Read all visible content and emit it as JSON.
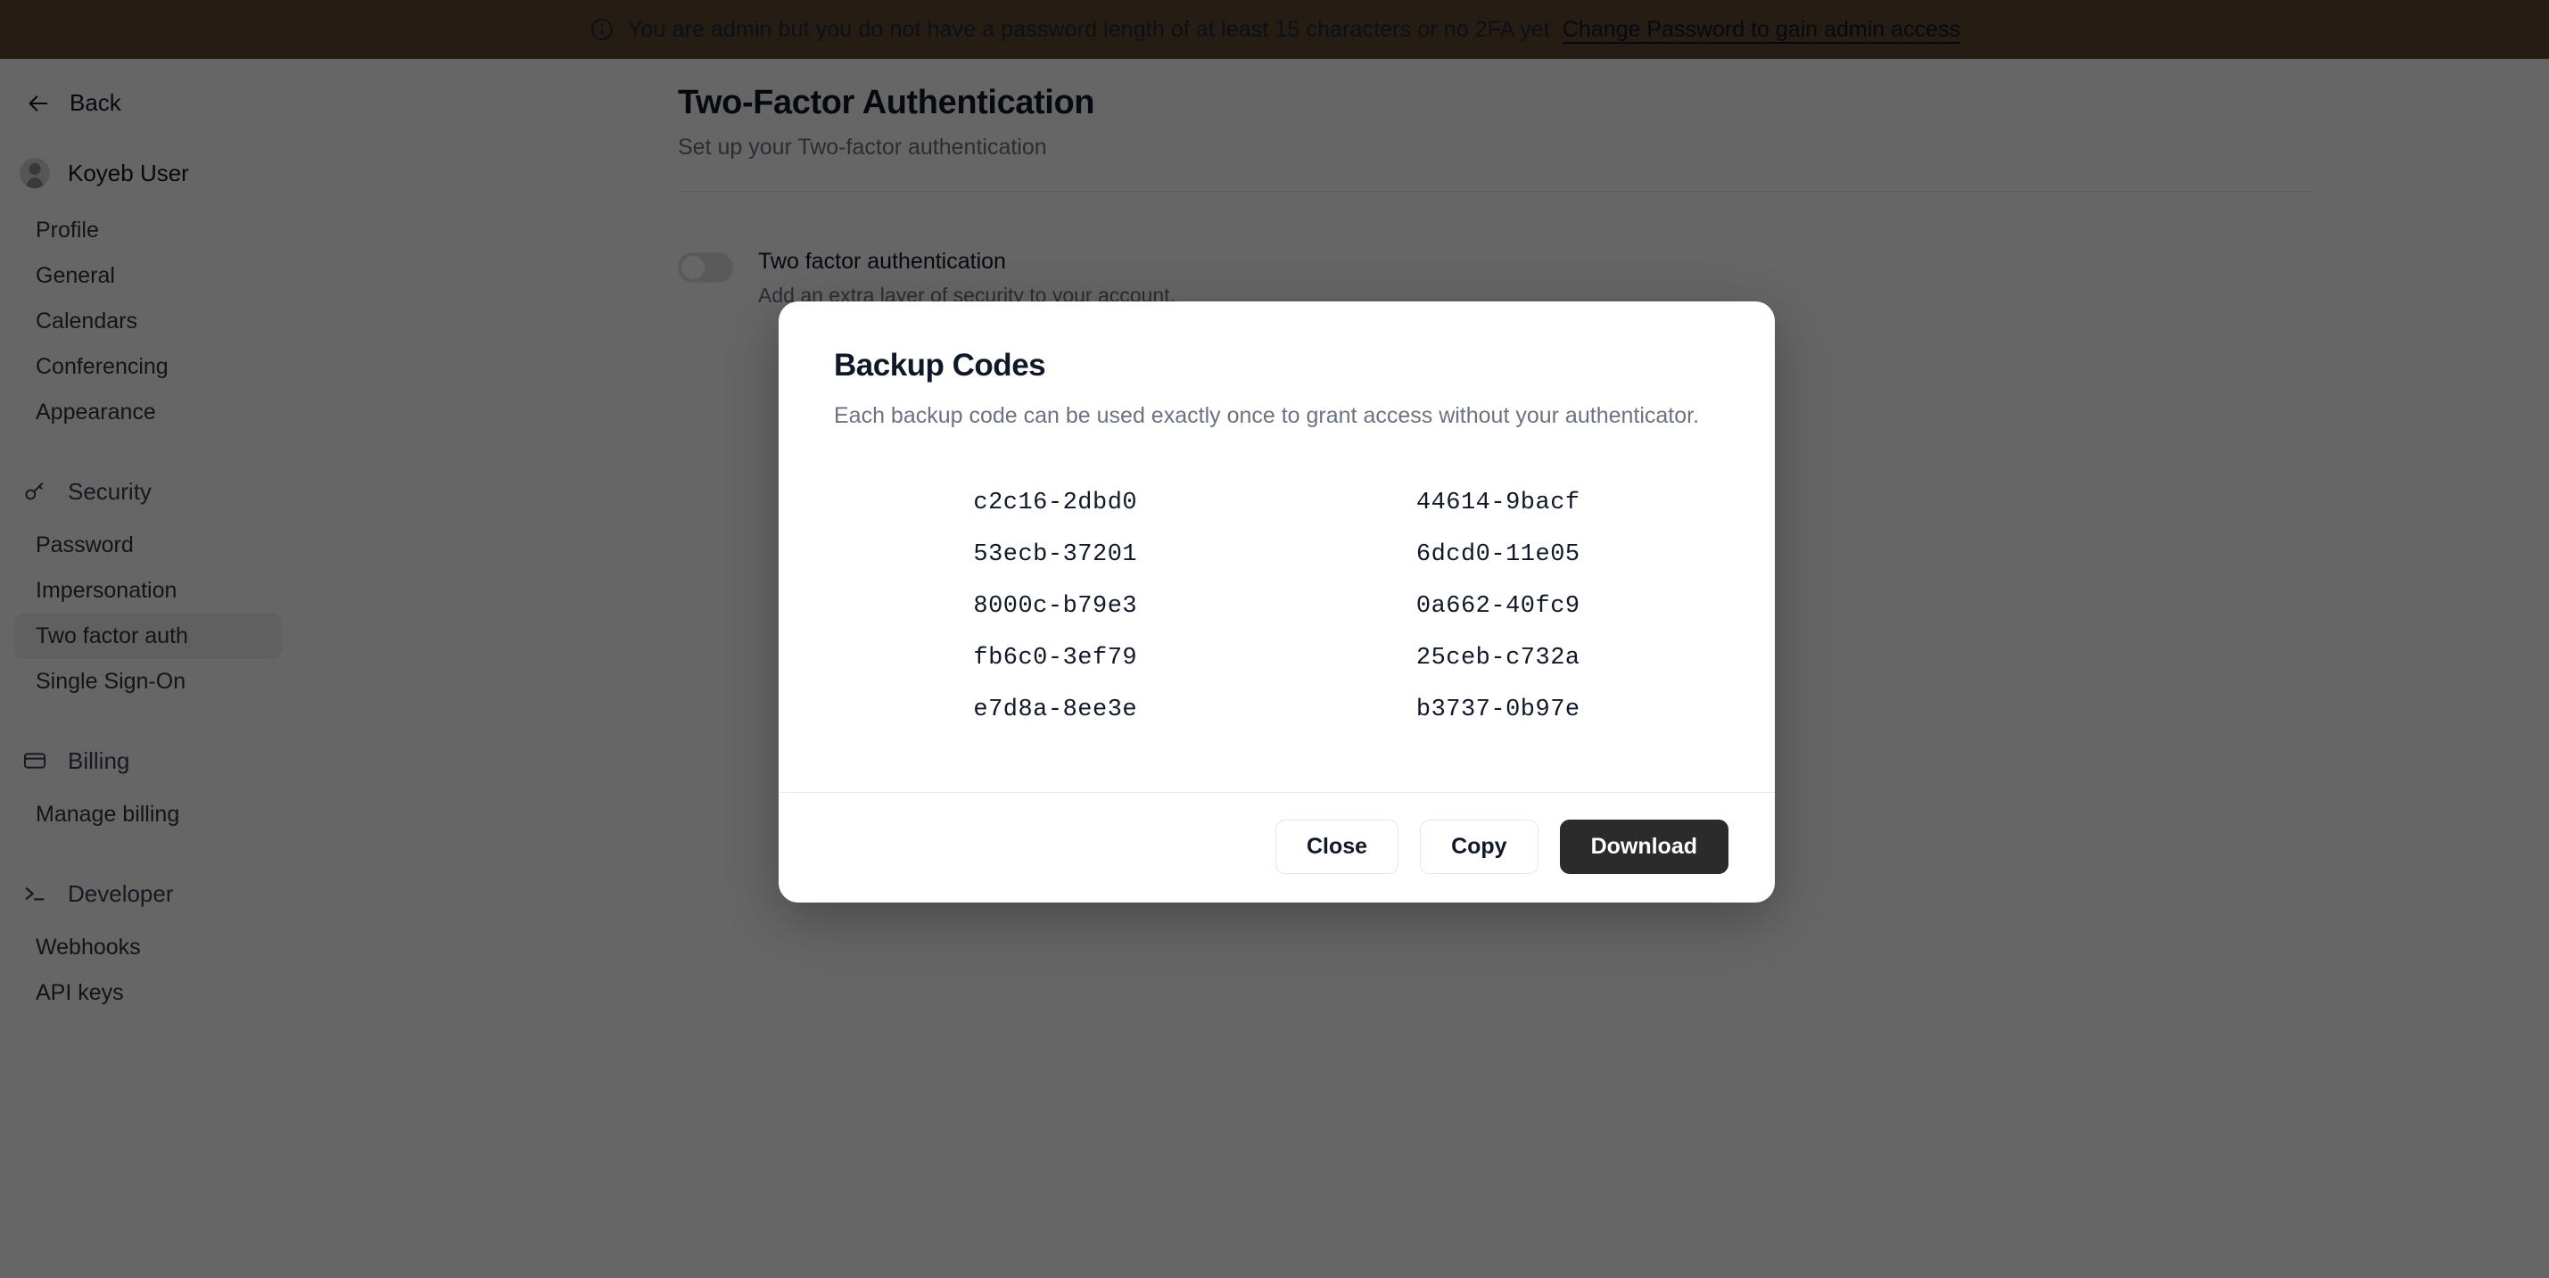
{
  "banner": {
    "icon": "info-circle-icon",
    "message": "You are admin but you do not have a password length of at least 15 characters or no 2FA yet",
    "link_label": "Change Password to gain admin access",
    "background_color": "#5d4634"
  },
  "sidebar": {
    "back_label": "Back",
    "back_icon": "arrow-left-icon",
    "user": {
      "name": "Koyeb User",
      "avatar_icon": "user-avatar-icon"
    },
    "account_items": [
      {
        "label": "Profile",
        "active": false
      },
      {
        "label": "General",
        "active": false
      },
      {
        "label": "Calendars",
        "active": false
      },
      {
        "label": "Conferencing",
        "active": false
      },
      {
        "label": "Appearance",
        "active": false
      }
    ],
    "groups": [
      {
        "label": "Security",
        "icon": "key-icon",
        "items": [
          {
            "label": "Password",
            "active": false
          },
          {
            "label": "Impersonation",
            "active": false
          },
          {
            "label": "Two factor auth",
            "active": true
          },
          {
            "label": "Single Sign-On",
            "active": false
          }
        ]
      },
      {
        "label": "Billing",
        "icon": "credit-card-icon",
        "items": [
          {
            "label": "Manage billing",
            "active": false
          }
        ]
      },
      {
        "label": "Developer",
        "icon": "terminal-icon",
        "items": [
          {
            "label": "Webhooks",
            "active": false
          },
          {
            "label": "API keys",
            "active": false
          }
        ]
      }
    ]
  },
  "main": {
    "title": "Two-Factor Authentication",
    "subtitle": "Set up your Two-factor authentication",
    "setting": {
      "toggle_on": false,
      "title": "Two factor authentication",
      "description": "Add an extra layer of security to your account."
    }
  },
  "modal": {
    "title": "Backup Codes",
    "description": "Each backup code can be used exactly once to grant access without your authenticator.",
    "codes_left": [
      "c2c16-2dbd0",
      "53ecb-37201",
      "8000c-b79e3",
      "fb6c0-3ef79",
      "e7d8a-8ee3e"
    ],
    "codes_right": [
      "44614-9bacf",
      "6dcd0-11e05",
      "0a662-40fc9",
      "25ceb-c732a",
      "b3737-0b97e"
    ],
    "buttons": {
      "close": "Close",
      "copy": "Copy",
      "download": "Download"
    },
    "primary_color": "#2b2b2b"
  }
}
